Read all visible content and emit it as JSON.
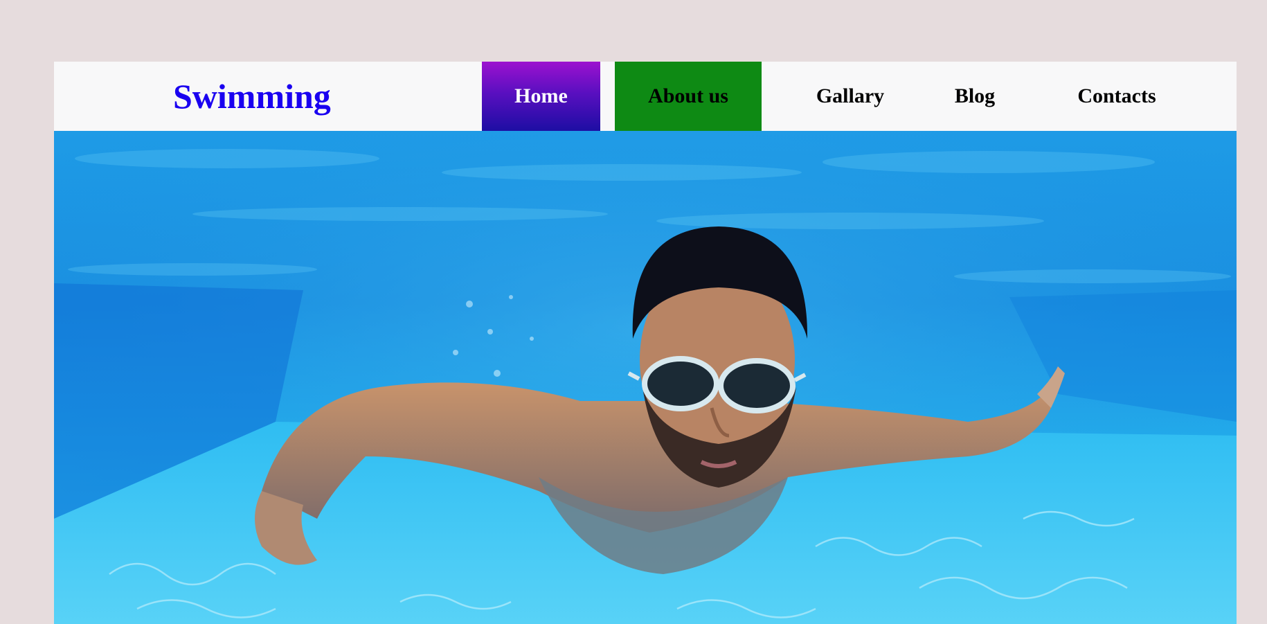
{
  "nav": {
    "brand": "Swimming",
    "items": [
      {
        "label": "Home"
      },
      {
        "label": "About us"
      },
      {
        "label": "Gallary"
      },
      {
        "label": "Blog"
      },
      {
        "label": "Contacts"
      }
    ],
    "colors": {
      "brand": "#1a00f0",
      "home_bg_top": "#9c12cf",
      "home_bg_bottom": "#1d0ea3",
      "about_bg": "#0e8a14",
      "bar_bg": "#f8f8f9",
      "page_bg": "#e6dcdd"
    }
  },
  "hero": {
    "image": "underwater-swimmer-photo"
  }
}
